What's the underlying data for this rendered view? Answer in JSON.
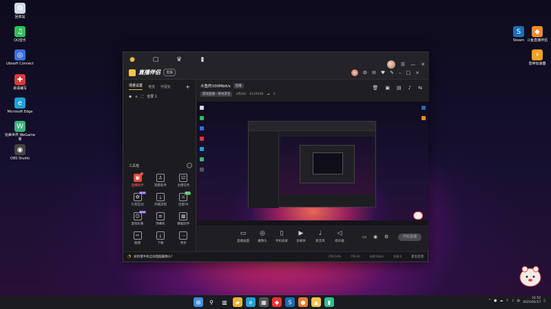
{
  "desktop": {
    "left_icons": [
      {
        "label": "回收站",
        "icon": "recycle-bin-icon",
        "color": "#cfd8e6"
      },
      {
        "label": "QQ音乐",
        "icon": "qq-music-icon",
        "color": "#2fbf5a"
      },
      {
        "label": "Ubisoft Connect",
        "icon": "ubisoft-icon",
        "color": "#3a6fd8"
      },
      {
        "label": "易语编写",
        "icon": "red-app-icon",
        "color": "#d83a3a"
      },
      {
        "label": "Microsoft Edge",
        "icon": "edge-icon",
        "color": "#1fa0d8"
      },
      {
        "label": "完美世界 WeGame版",
        "icon": "wegame-icon",
        "color": "#3ab37a"
      },
      {
        "label": "OBS Studio",
        "icon": "obs-icon",
        "color": "#444444"
      }
    ],
    "right_icons": [
      {
        "label": "Steam",
        "icon": "steam-icon",
        "color": "#1b6fb5"
      },
      {
        "label": "斗鱼直播伴侣",
        "icon": "douyu-icon",
        "color": "#f08a2a"
      },
      {
        "label": "雷神加速器",
        "icon": "accelerator-icon",
        "color": "#f5a020"
      }
    ]
  },
  "app": {
    "brand": "直播伴侣",
    "version_chip": "发版",
    "left_tabs": [
      "场景设置",
      "竞技",
      "可视化"
    ],
    "scene_name": "全屏 1",
    "toolbox_title": "工具箱",
    "tools": [
      {
        "label": "直播助手",
        "icon": "camera-icon",
        "highlight": true,
        "badge": "dot"
      },
      {
        "label": "观看助手",
        "icon": "user-icon",
        "highlight": false,
        "badge": ""
      },
      {
        "label": "主播任务",
        "icon": "task-icon",
        "highlight": false,
        "badge": ""
      },
      {
        "label": "礼物互动",
        "icon": "gift-icon",
        "highlight": false,
        "badge": "NEW"
      },
      {
        "label": "开播流程",
        "icon": "download-icon",
        "highlight": false,
        "badge": ""
      },
      {
        "label": "连麦PK",
        "icon": "pk-icon",
        "highlight": false,
        "badge": "热门"
      },
      {
        "label": "虚拟形象",
        "icon": "avatar-icon",
        "highlight": false,
        "badge": "NEW"
      },
      {
        "label": "弹幕机",
        "icon": "barrage-icon",
        "highlight": false,
        "badge": ""
      },
      {
        "label": "数据助手",
        "icon": "data-icon",
        "highlight": false,
        "badge": ""
      },
      {
        "label": "截图",
        "icon": "screenshot-icon",
        "highlight": false,
        "badge": ""
      },
      {
        "label": "下载",
        "icon": "download-icon",
        "highlight": false,
        "badge": ""
      },
      {
        "label": "更多",
        "icon": "more-icon",
        "highlight": false,
        "badge": ""
      }
    ],
    "room": {
      "title": "斗鱼的100Mbit/s",
      "title_chip": "直播",
      "category": "游戏直播 - 绝地求生",
      "date": "4月8日",
      "id": "6119548",
      "viewers": "0"
    },
    "bottom_tools": [
      {
        "label": "直播画面",
        "icon": "monitor-icon"
      },
      {
        "label": "摄像头",
        "icon": "webcam-icon"
      },
      {
        "label": "手机投屏",
        "icon": "phone-cast-icon"
      },
      {
        "label": "多媒体",
        "icon": "media-icon"
      },
      {
        "label": "麦克风",
        "icon": "microphone-icon"
      },
      {
        "label": "扬声器",
        "icon": "speaker-icon"
      }
    ],
    "start_button": "开始直播",
    "status_msg": "如何使手机启动电脑摄像头?",
    "stats": [
      "CPU:24%",
      "FPS:30",
      "码率:0kb/s",
      "丢帧:0"
    ],
    "feedback": "意见反馈"
  },
  "taskbar": {
    "time": "21:52",
    "date": "2021/01/17",
    "apps": [
      "windows-start-icon",
      "search-icon",
      "task-view-icon",
      "file-explorer-icon",
      "edge-icon",
      "store-icon",
      "douyu-icon",
      "steam-icon",
      "firefox-icon",
      "live-companion-icon",
      "terminal-icon"
    ]
  }
}
